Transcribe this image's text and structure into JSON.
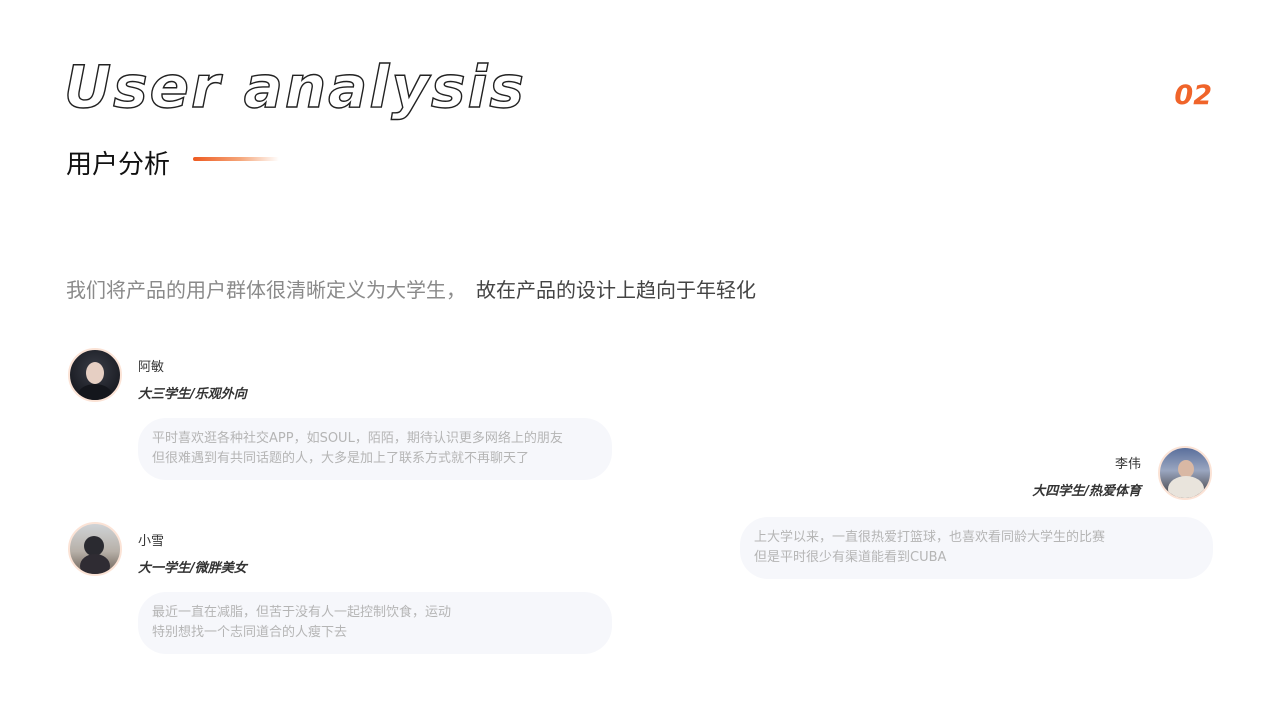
{
  "header": {
    "title_en": "User analysis",
    "title_cn": "用户分析",
    "page_number": "02"
  },
  "intro": {
    "part1": "我们将产品的用户群体很清晰定义为大学生，",
    "part2": "故在产品的设计上趋向于年轻化"
  },
  "users": [
    {
      "name": "阿敏",
      "role": "大三学生/乐观外向",
      "quote": [
        "平时喜欢逛各种社交APP，如SOUL，陌陌，期待认识更多网络上的朋友",
        "但很难遇到有共同话题的人，大多是加上了联系方式就不再聊天了"
      ]
    },
    {
      "name": "李伟",
      "role": "大四学生/热爱体育",
      "quote": [
        "上大学以来，一直很热爱打篮球，也喜欢看同龄大学生的比赛",
        "但是平时很少有渠道能看到CUBA"
      ]
    },
    {
      "name": "小雪",
      "role": "大一学生/微胖美女",
      "quote": [
        "最近一直在减脂，但苦于没有人一起控制饮食，运动",
        "特别想找一个志同道合的人瘦下去"
      ]
    }
  ],
  "colors": {
    "accent": "#f0642a",
    "bubble_bg": "#f6f7fb"
  }
}
